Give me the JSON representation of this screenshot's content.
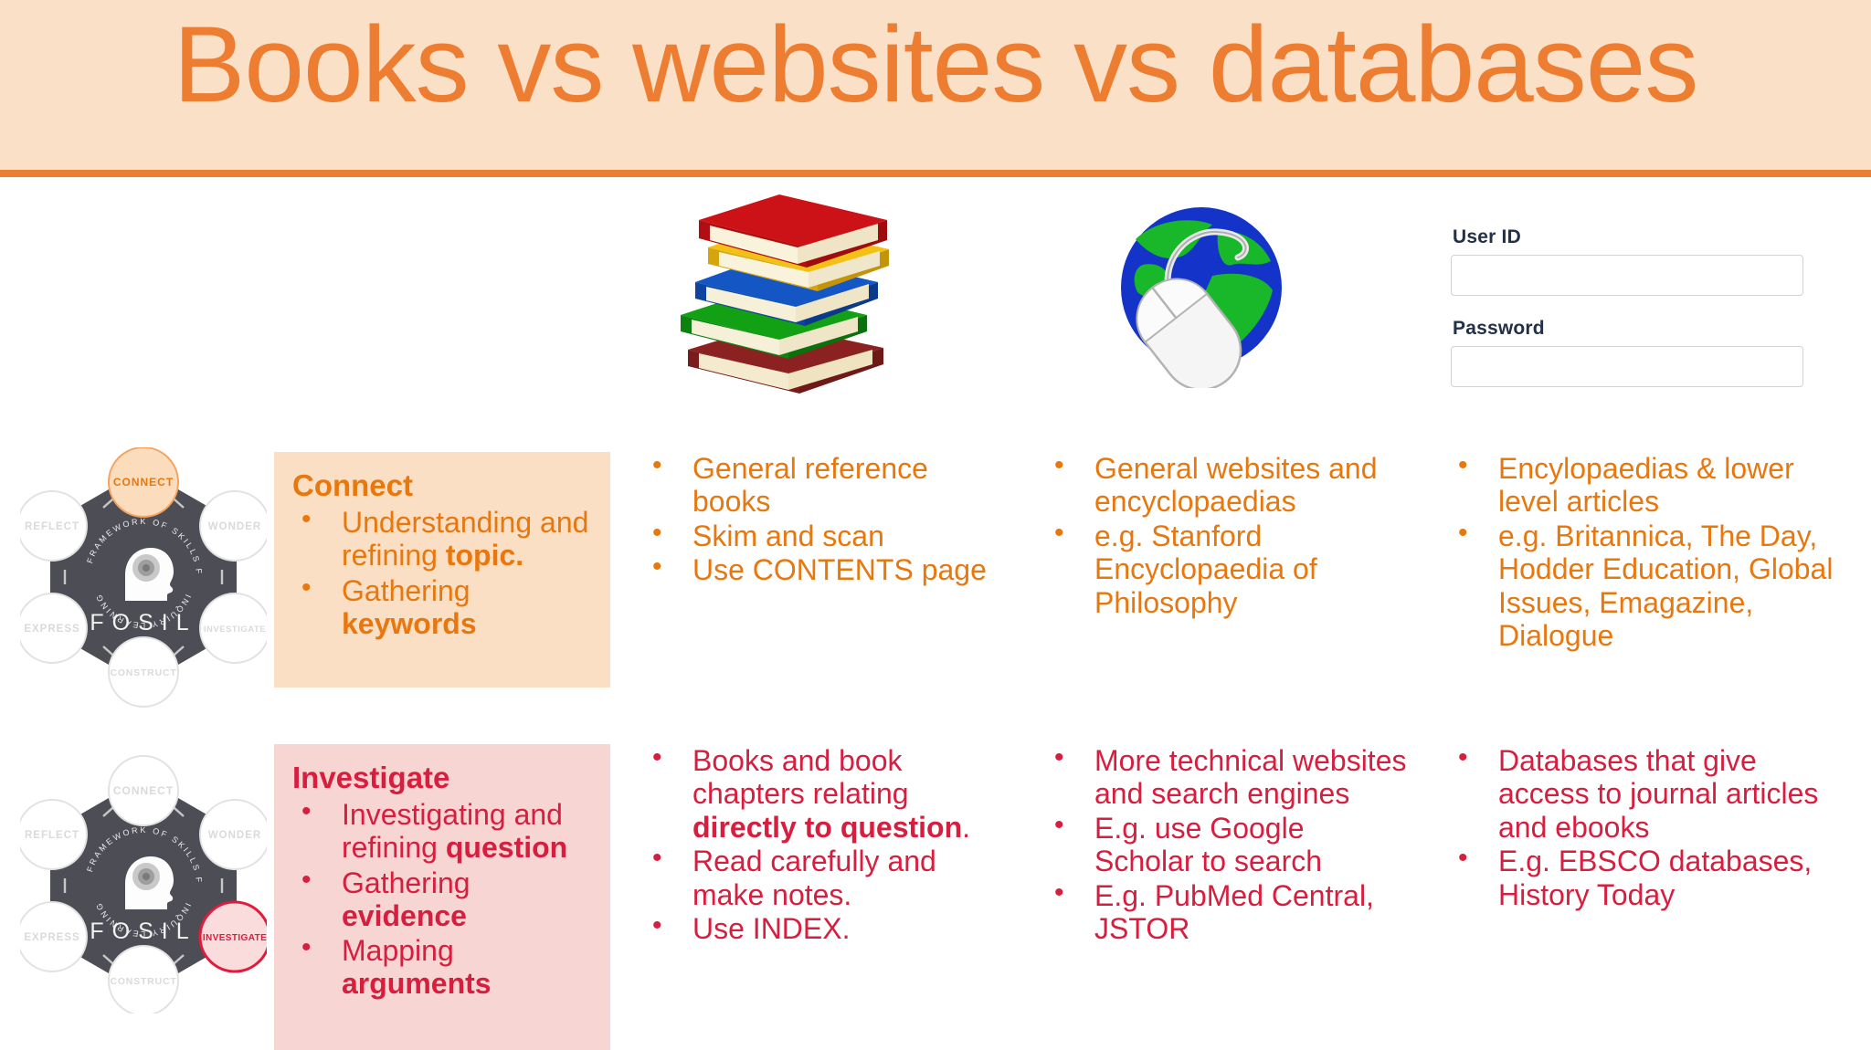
{
  "header": {
    "title": "Books vs websites vs databases",
    "bg_color": "#FBE0C8",
    "accent_color": "#ED7D31"
  },
  "icons": {
    "books": {
      "name": "stack-of-books-image",
      "book_colors": [
        "#CC1216",
        "#F3C016",
        "#1356C4",
        "#12A014",
        "#8C2121"
      ]
    },
    "globe_mouse": {
      "name": "globe-with-mouse-image",
      "globe_color": "#1433C8",
      "land_color": "#18B82A",
      "mouse_color": "#F2F2F2"
    }
  },
  "login": {
    "user_id_label": "User ID",
    "user_id_value": "",
    "user_id_placeholder": "",
    "password_label": "Password",
    "password_value": "",
    "password_placeholder": ""
  },
  "fosil": {
    "center_word": "FOSIL",
    "ring_text": "FRAMEWORK OF SKILLS FOR INQUIRY LEARNING",
    "nodes": [
      "CONNECT",
      "WONDER",
      "INVESTIGATE",
      "CONSTRUCT",
      "EXPRESS",
      "REFLECT"
    ],
    "wheel_connect": {
      "name": "fosil-wheel-connect",
      "active_node": "CONNECT",
      "active_color": "#F8A14C",
      "hub_color": "#4D4D55"
    },
    "wheel_investigate": {
      "name": "fosil-wheel-investigate",
      "active_node": "INVESTIGATE",
      "active_color": "#E21B3C",
      "hub_color": "#4D4D55"
    }
  },
  "rows": [
    {
      "id": "connect",
      "accent_color": "#E8770E",
      "box_bg": "#FBDFC4",
      "heading": "Connect",
      "stage_bullets": [
        {
          "parts": [
            {
              "t": "Understanding and refining ",
              "b": false
            },
            {
              "t": "topic.",
              "b": true
            }
          ]
        },
        {
          "parts": [
            {
              "t": "Gathering ",
              "b": false
            },
            {
              "t": "keywords",
              "b": true
            }
          ]
        }
      ],
      "books": [
        {
          "parts": [
            {
              "t": "General reference books",
              "b": false
            }
          ]
        },
        {
          "parts": [
            {
              "t": "Skim and scan",
              "b": false
            }
          ]
        },
        {
          "parts": [
            {
              "t": "Use CONTENTS page",
              "b": false
            }
          ]
        }
      ],
      "websites": [
        {
          "parts": [
            {
              "t": "General websites and encyclopaedias",
              "b": false
            }
          ]
        },
        {
          "parts": [
            {
              "t": "e.g. Stanford Encyclopaedia of Philosophy",
              "b": false
            }
          ]
        }
      ],
      "databases": [
        {
          "parts": [
            {
              "t": "Encylopaedias & lower level articles",
              "b": false
            }
          ]
        },
        {
          "parts": [
            {
              "t": "e.g. Britannica, The Day, Hodder Education, Global Issues, Emagazine, Dialogue",
              "b": false
            }
          ]
        }
      ]
    },
    {
      "id": "investigate",
      "accent_color": "#D81E3F",
      "box_bg": "#F7D5D3",
      "heading": "Investigate",
      "stage_bullets": [
        {
          "parts": [
            {
              "t": "Investigating and refining ",
              "b": false
            },
            {
              "t": "question",
              "b": true
            }
          ]
        },
        {
          "parts": [
            {
              "t": "Gathering ",
              "b": false
            },
            {
              "t": "evidence",
              "b": true
            }
          ]
        },
        {
          "parts": [
            {
              "t": "Mapping ",
              "b": false
            },
            {
              "t": "arguments",
              "b": true
            }
          ]
        }
      ],
      "books": [
        {
          "parts": [
            {
              "t": "Books and book chapters relating ",
              "b": false
            },
            {
              "t": "directly to question",
              "b": true
            },
            {
              "t": ".",
              "b": false
            }
          ]
        },
        {
          "parts": [
            {
              "t": "Read carefully and make notes.",
              "b": false
            }
          ]
        },
        {
          "parts": [
            {
              "t": "Use INDEX.",
              "b": false
            }
          ]
        }
      ],
      "websites": [
        {
          "parts": [
            {
              "t": "More technical websites and search engines",
              "b": false
            }
          ]
        },
        {
          "parts": [
            {
              "t": "E.g. use Google Scholar to search",
              "b": false
            }
          ]
        },
        {
          "parts": [
            {
              "t": "E.g. PubMed Central, JSTOR",
              "b": false
            }
          ]
        }
      ],
      "databases": [
        {
          "parts": [
            {
              "t": "Databases that give access to journal articles and ebooks",
              "b": false
            }
          ]
        },
        {
          "parts": [
            {
              "t": "E.g. EBSCO databases, History Today",
              "b": false
            }
          ]
        }
      ]
    }
  ]
}
